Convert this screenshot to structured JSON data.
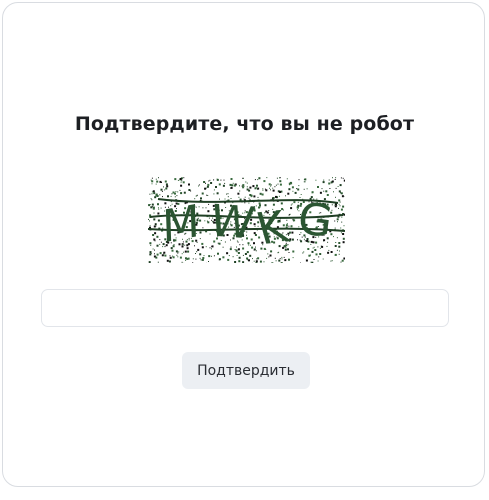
{
  "dialog": {
    "title": "Подтвердите, что вы не робот",
    "captcha_text": "MWKG",
    "answer_value": "",
    "answer_placeholder": "",
    "submit_label": "Подтвердить"
  }
}
